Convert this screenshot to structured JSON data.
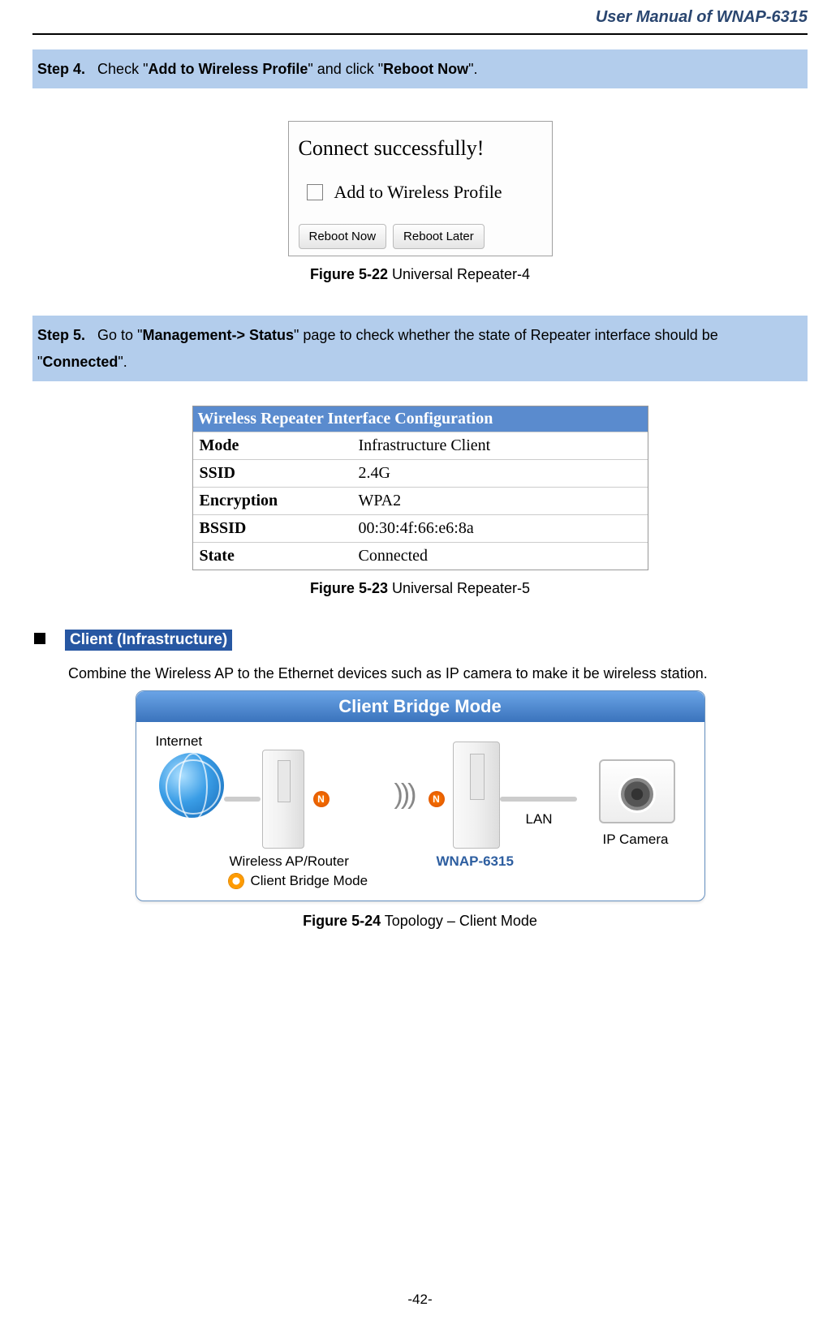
{
  "header": {
    "title": "User Manual of WNAP-6315"
  },
  "step4": {
    "label": "Step 4.",
    "prefix": "Check \"",
    "bold1": "Add to Wireless Profile",
    "mid": "\" and click \"",
    "bold2": "Reboot Now",
    "suffix": "\"."
  },
  "dialog1": {
    "title": "Connect successfully!",
    "checkbox_label": "Add to Wireless Profile",
    "btn_reboot_now": "Reboot Now",
    "btn_reboot_later": "Reboot Later"
  },
  "caption1": {
    "bold": "Figure 5-22",
    "rest": " Universal Repeater-4"
  },
  "step5": {
    "label": "Step 5.",
    "prefix": "Go to \"",
    "bold1": "Management-> Status",
    "mid": "\" page to check whether the state of Repeater interface should be \"",
    "bold2": "Connected",
    "suffix": "\"."
  },
  "config": {
    "header": "Wireless Repeater Interface Configuration",
    "rows": [
      {
        "label": "Mode",
        "value": "Infrastructure Client"
      },
      {
        "label": "SSID",
        "value": "2.4G"
      },
      {
        "label": "Encryption",
        "value": "WPA2"
      },
      {
        "label": "BSSID",
        "value": "00:30:4f:66:e6:8a"
      },
      {
        "label": "State",
        "value": "Connected"
      }
    ]
  },
  "caption2": {
    "bold": "Figure 5-23",
    "rest": " Universal Repeater-5"
  },
  "section": {
    "title": "Client (Infrastructure)",
    "body": "Combine the Wireless AP to the Ethernet devices such as IP camera to make it be wireless station."
  },
  "topology": {
    "title": "Client Bridge Mode",
    "internet": "Internet",
    "ap_label": "Wireless AP/Router",
    "bridge_mode": "Client Bridge Mode",
    "wnap": "WNAP-6315",
    "lan": "LAN",
    "ipcam": "IP Camera",
    "n": "N"
  },
  "caption3": {
    "bold": "Figure 5-24",
    "rest": " Topology – Client Mode"
  },
  "page_number": "-42-"
}
